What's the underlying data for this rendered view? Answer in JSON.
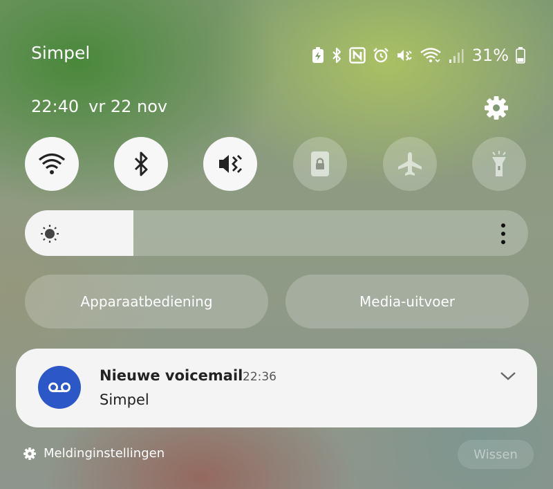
{
  "status_bar": {
    "carrier": "Simpel",
    "battery_percent": "31%",
    "icons": [
      "battery-saver-icon",
      "bluetooth-icon",
      "nfc-icon",
      "alarm-icon",
      "mute-icon",
      "wifi-icon",
      "signal-icon",
      "battery-icon"
    ]
  },
  "header": {
    "time": "22:40",
    "date": "vr 22 nov",
    "settings_icon": "gear-icon"
  },
  "quick_tiles": [
    {
      "name": "wifi",
      "icon": "wifi-icon",
      "state": "on"
    },
    {
      "name": "bluetooth",
      "icon": "bluetooth-icon",
      "state": "on"
    },
    {
      "name": "sound",
      "icon": "mute-icon",
      "state": "on"
    },
    {
      "name": "screen-lock",
      "icon": "lock-rotation-icon",
      "state": "off"
    },
    {
      "name": "airplane",
      "icon": "airplane-icon",
      "state": "off"
    },
    {
      "name": "flashlight",
      "icon": "flashlight-icon",
      "state": "off"
    }
  ],
  "brightness": {
    "level": 0.215
  },
  "buttons": {
    "device_control": "Apparaatbediening",
    "media_output": "Media-uitvoer"
  },
  "notification": {
    "title": "Nieuwe voicemail",
    "time": "22:36",
    "body": "Simpel",
    "icon": "voicemail-icon"
  },
  "footer": {
    "settings_label": "Meldinginstellingen",
    "clear_label": "Wissen"
  },
  "colors": {
    "notification_icon_bg": "#2c57c7",
    "tile_on_bg": "#f7f7f7"
  }
}
